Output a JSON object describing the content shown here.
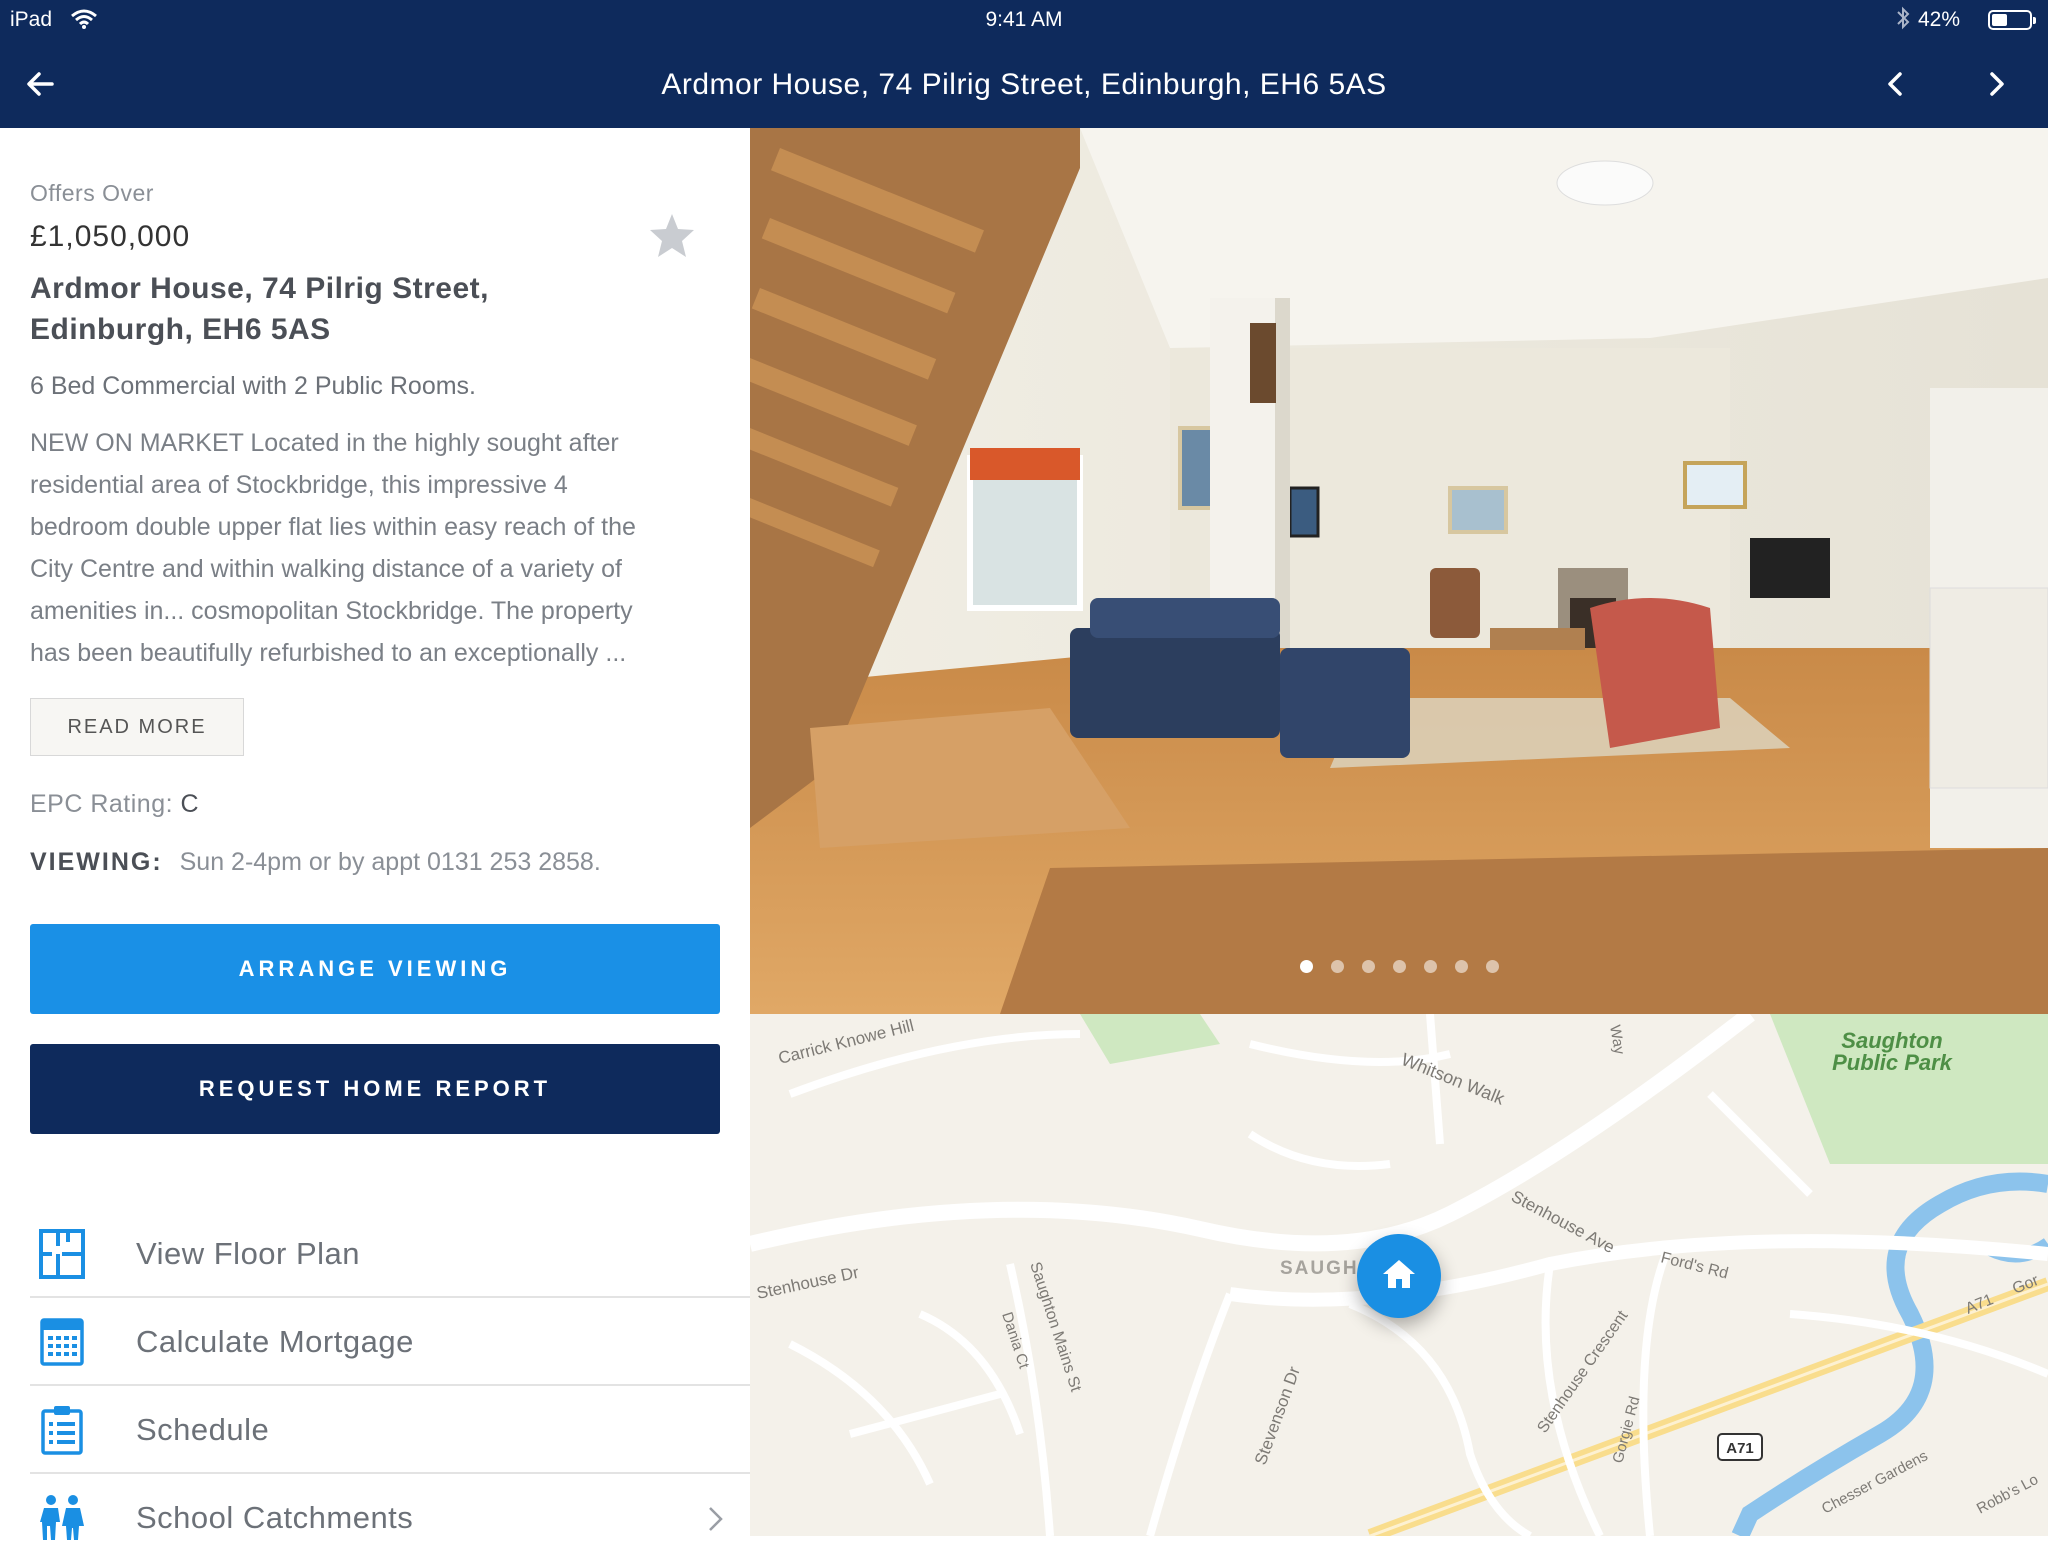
{
  "status_bar": {
    "device": "iPad",
    "time": "9:41 AM",
    "battery": "42%",
    "battery_level": 0.42
  },
  "nav": {
    "title": "Ardmor House, 74 Pilrig Street, Edinburgh, EH6 5AS",
    "back_icon": "arrow-left-icon",
    "prev_icon": "chevron-left-icon",
    "next_icon": "chevron-right-icon"
  },
  "listing": {
    "offer_label": "Offers Over",
    "price": "£1,050,000",
    "address_line1": "Ardmor House, 74 Pilrig Street,",
    "address_line2": "Edinburgh, EH6 5AS",
    "summary": "6 Bed Commercial with 2 Public Rooms.",
    "description_lines": [
      "NEW ON MARKET Located in the highly sought after",
      "residential area of Stockbridge, this impressive 4",
      "bedroom double upper flat lies within easy reach of the",
      "City Centre and within walking distance of a variety of",
      "amenities in... cosmopolitan Stockbridge. The property",
      "has been beautifully refurbished to an exceptionally ..."
    ],
    "read_more": "READ MORE",
    "epc_label": "EPC Rating:",
    "epc_value": "C",
    "viewing_label": "VIEWING:",
    "viewing_value": "Sun 2-4pm or by appt 0131 253 2858.",
    "favorite_icon": "star-icon"
  },
  "actions": {
    "arrange_viewing": "ARRANGE VIEWING",
    "request_home_report": "REQUEST HOME REPORT",
    "primary_color": "#1a90e6",
    "navy_color": "#0e2a5c"
  },
  "menu": [
    {
      "label": "View Floor Plan",
      "icon": "floor-plan-icon"
    },
    {
      "label": "Calculate Mortgage",
      "icon": "calculator-icon"
    },
    {
      "label": "Schedule",
      "icon": "clipboard-list-icon"
    },
    {
      "label": "School Catchments",
      "icon": "school-children-icon"
    }
  ],
  "gallery": {
    "image_count": 7,
    "active_index": 0
  },
  "map": {
    "labels": {
      "carrick": "Carrick Knowe Hill",
      "whitson": "Whitson Walk",
      "way": "Way",
      "park_line1": "Saughton",
      "park_line2": "Public Park",
      "stenhouse_dr": "Stenhouse Dr",
      "saughton_mains": "Saughton Mains St",
      "dania": "Dania Ct",
      "saugh": "SAUGH",
      "stenhouse_ave": "Stenhouse Ave",
      "fords": "Ford's Rd",
      "stenhouse_cres": "Stenhouse Crescent",
      "gorgie": "Gorgie Rd",
      "stevenson": "Stevenson Dr",
      "a71_road": "A71",
      "gor": "Gor",
      "a71_shield": "A71",
      "chesser": "Chesser Gardens",
      "robbs": "Robb's Lo"
    },
    "pin_icon": "home-icon"
  }
}
